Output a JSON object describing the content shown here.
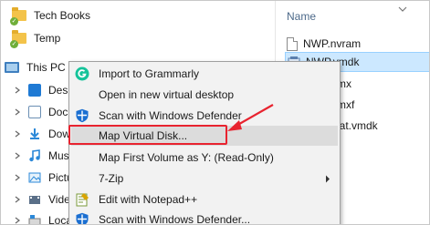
{
  "nav": {
    "quick_access": [
      {
        "label": "Tech Books",
        "icon": "folder-synced-icon"
      },
      {
        "label": "Temp",
        "icon": "folder-synced-icon"
      }
    ],
    "this_pc": {
      "label": "This PC",
      "icon": "computer-icon"
    },
    "children": [
      {
        "label": "Desktop",
        "icon": "desktop-folder-icon",
        "color": "#1f7ad4"
      },
      {
        "label": "Docum",
        "icon": "documents-folder-icon",
        "color": "#6b8fb4"
      },
      {
        "label": "Downlo",
        "icon": "downloads-folder-icon",
        "color": "#2b88d8"
      },
      {
        "label": "Music",
        "icon": "music-folder-icon",
        "color": "#2b88d8"
      },
      {
        "label": "Picture",
        "icon": "pictures-folder-icon",
        "color": "#2b88d8"
      },
      {
        "label": "Videos",
        "icon": "videos-folder-icon",
        "color": "#6b8fb4"
      },
      {
        "label": "Local D",
        "icon": "local-disk-icon",
        "color": "#7a7a7a"
      }
    ]
  },
  "files": {
    "column_header": "Name",
    "items": [
      {
        "label": "NWP.nvram",
        "icon": "document-icon",
        "selected": false
      },
      {
        "label": "NWP.vmdk",
        "icon": "vmdk-disk-icon",
        "selected": true
      },
      {
        "label": "mx",
        "icon": "document-icon",
        "selected": false
      },
      {
        "label": "mxf",
        "icon": "document-icon",
        "selected": false
      },
      {
        "label": "lat.vmdk",
        "icon": "vmdk-disk-icon",
        "selected": false
      }
    ]
  },
  "context_menu": {
    "items": [
      {
        "label": "Import to Grammarly",
        "icon": "grammarly-icon",
        "submenu": false,
        "highlighted": false
      },
      {
        "label": "Open in new virtual desktop",
        "icon": "",
        "submenu": false,
        "highlighted": false
      },
      {
        "label": "Scan with Windows Defender",
        "icon": "windows-defender-icon",
        "submenu": false,
        "highlighted": false
      },
      {
        "label": "Map Virtual Disk...",
        "icon": "",
        "submenu": false,
        "highlighted": true
      },
      {
        "label": "Map First Volume as Y: (Read-Only)",
        "icon": "",
        "submenu": false,
        "highlighted": false
      },
      {
        "label": "7-Zip",
        "icon": "",
        "submenu": true,
        "highlighted": false
      },
      {
        "label": "Edit with Notepad++",
        "icon": "notepad-plus-plus-icon",
        "submenu": false,
        "highlighted": false
      },
      {
        "label": "Scan with Windows Defender...",
        "icon": "windows-defender-icon",
        "submenu": false,
        "highlighted": false
      }
    ]
  },
  "colors": {
    "annotation_red": "#e8232f",
    "grammarly_green": "#15c39a",
    "defender_blue": "#1b6fd1",
    "selection_blue": "#cce8ff"
  }
}
